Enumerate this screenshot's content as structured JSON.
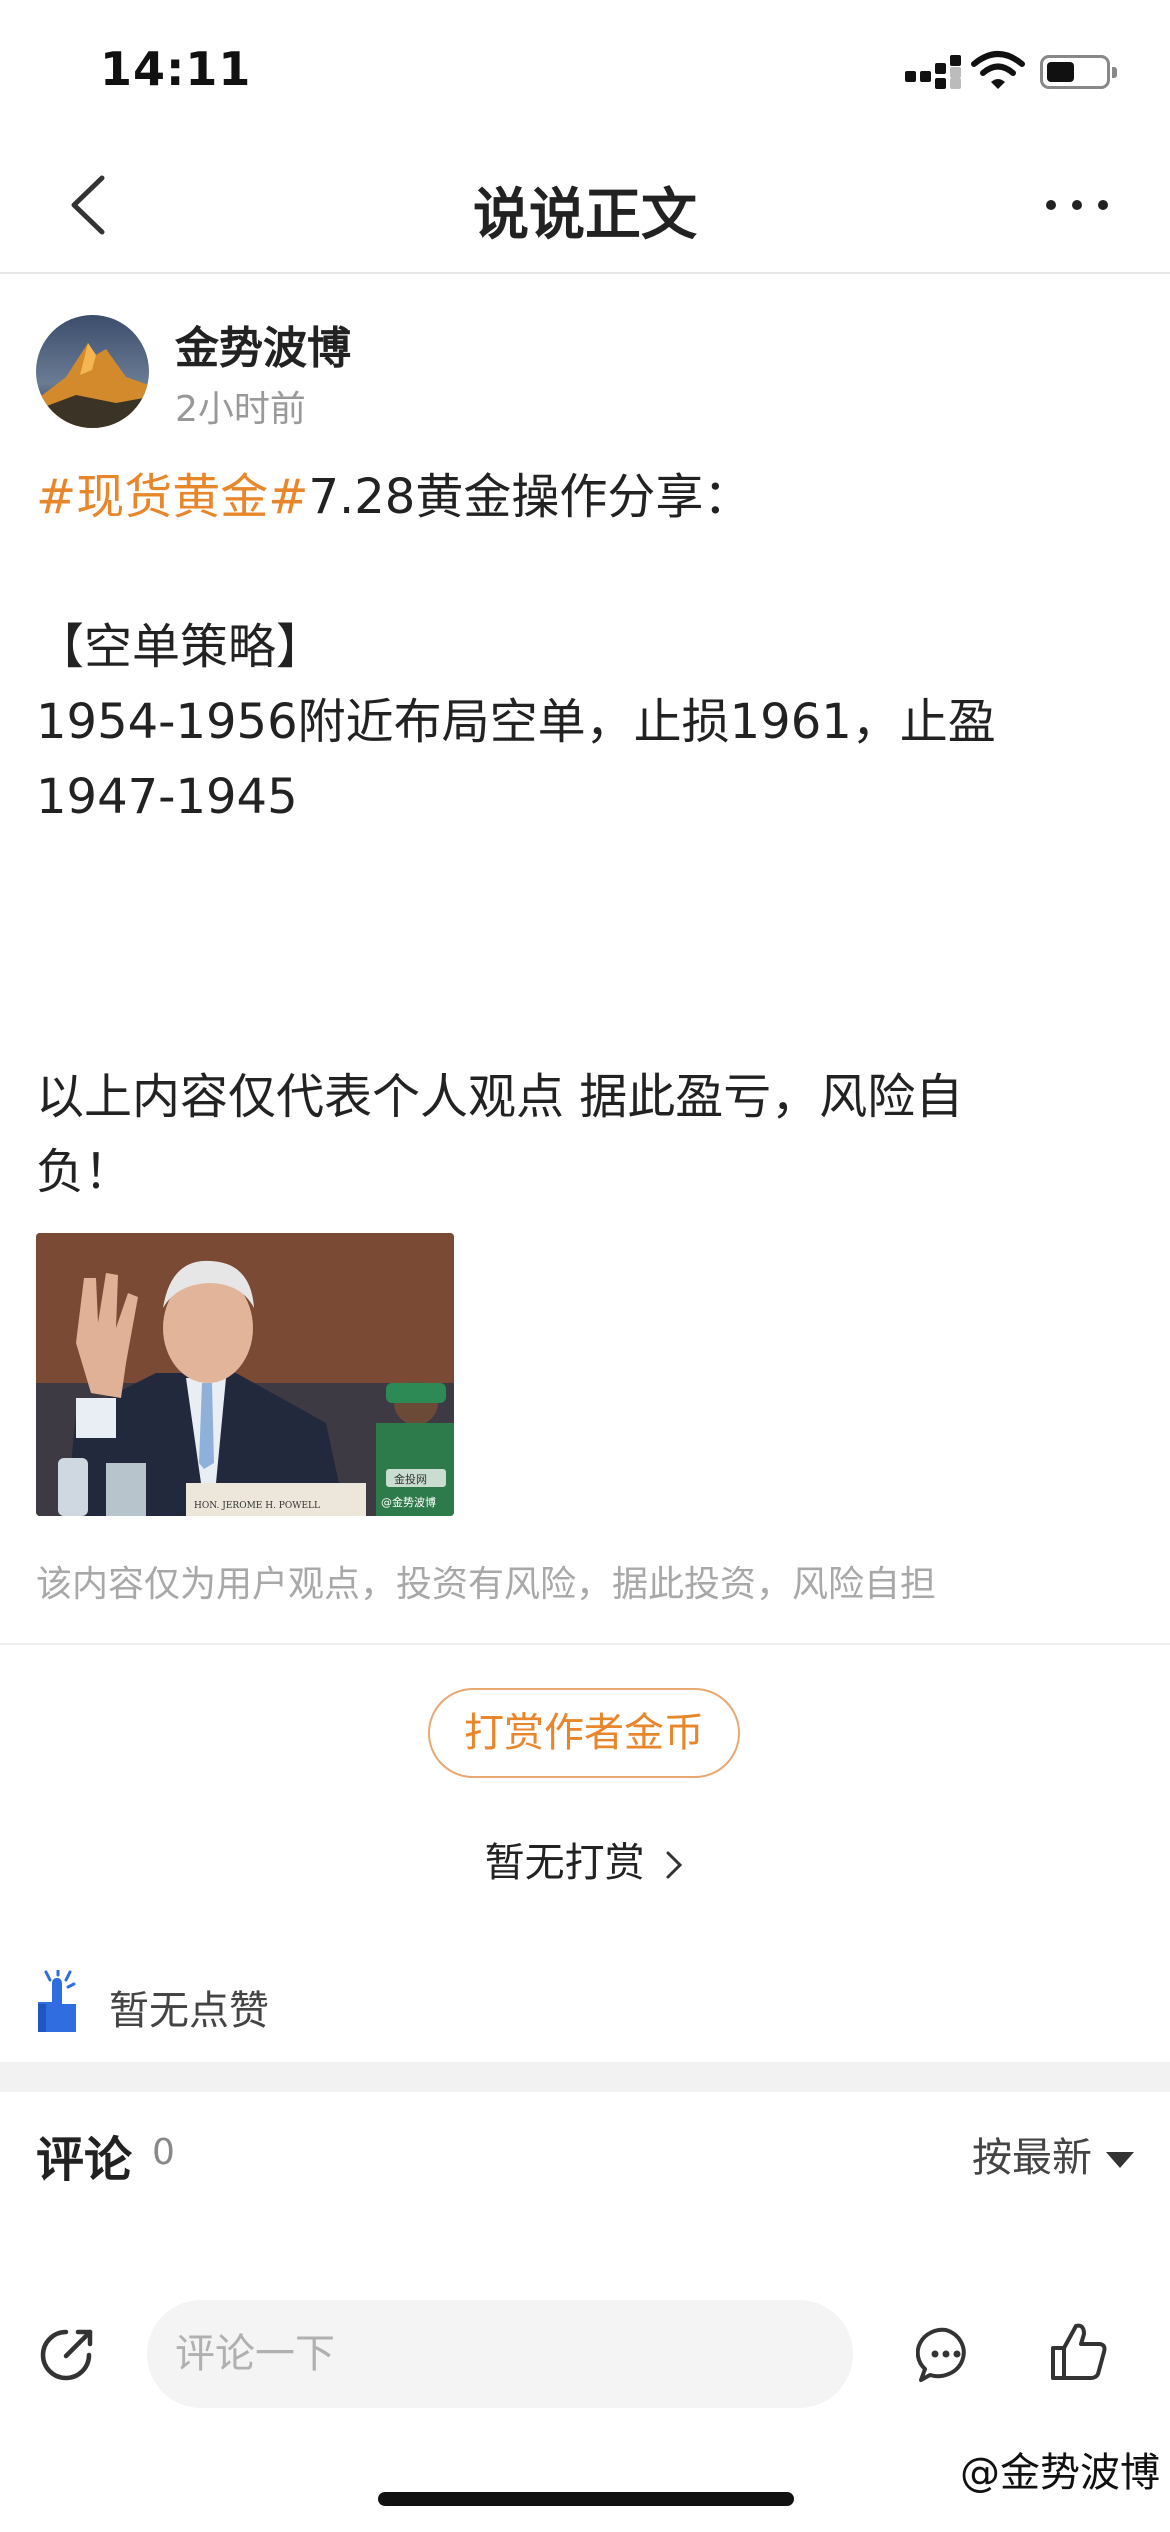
{
  "status_bar": {
    "time": "14:11",
    "battery_level": 0.5
  },
  "nav": {
    "title": "说说正文"
  },
  "author": {
    "name": "金势波博",
    "time": "2小时前"
  },
  "post": {
    "hashtag": "#现货黄金#",
    "headline_rest": "7.28黄金操作分享：",
    "section_title": "【空单策略】",
    "strategy_line1": "1954-1956附近布局空单，止损1961，止盈",
    "strategy_line2": "1947-1945",
    "risk_line1": "以上内容仅代表个人观点 据此盈亏，风险自",
    "risk_line2": "负！",
    "image_caption_top": "金投网",
    "image_caption_bottom": "@金势波博",
    "image_nameplate": "HON. JEROME H. POWELL",
    "disclaimer": "该内容仅为用户观点，投资有风险，据此投资，风险自担"
  },
  "tip": {
    "button_label": "打赏作者金币",
    "status": "暂无打赏"
  },
  "likes": {
    "status": "暂无点赞"
  },
  "comments": {
    "title": "评论",
    "count": "0",
    "sort_label": "按最新"
  },
  "bottom_bar": {
    "comment_placeholder": "评论一下"
  },
  "watermark": "@金势波博",
  "colors": {
    "accent": "#e8862b",
    "like_blue": "#2f6de1",
    "muted": "#999999"
  }
}
